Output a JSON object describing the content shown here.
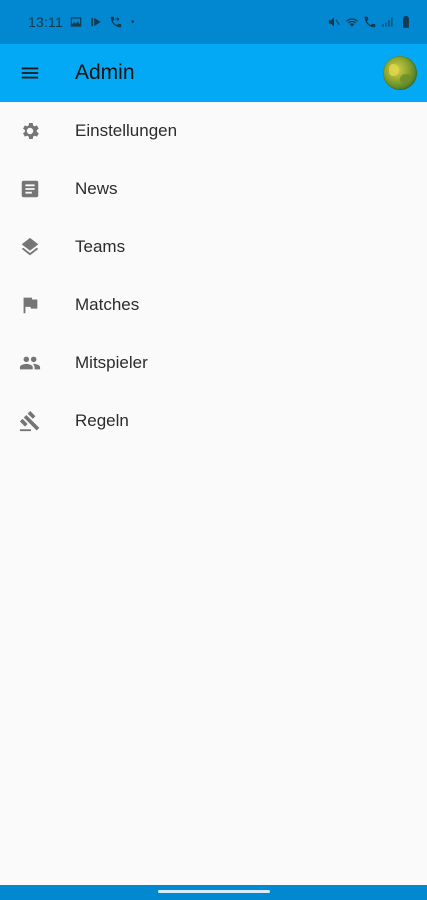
{
  "status_bar": {
    "time": "13:11",
    "left_icons": [
      "gallery-icon",
      "play-icon",
      "call-forward-icon"
    ],
    "dot": "•",
    "right_icons": [
      "mute-icon",
      "wifi-icon",
      "volte-icon",
      "signal-icon",
      "battery-icon"
    ]
  },
  "app_bar": {
    "title": "Admin",
    "menu_icon": "hamburger-menu-icon",
    "avatar": "user-avatar",
    "background": "#03a9f4"
  },
  "menu": {
    "items": [
      {
        "label": "Einstellungen",
        "icon": "gear-icon"
      },
      {
        "label": "News",
        "icon": "article-icon"
      },
      {
        "label": "Teams",
        "icon": "layers-icon"
      },
      {
        "label": "Matches",
        "icon": "flag-icon"
      },
      {
        "label": "Mitspieler",
        "icon": "people-icon"
      },
      {
        "label": "Regeln",
        "icon": "gavel-icon"
      }
    ]
  },
  "colors": {
    "status_bar": "#0288d1",
    "app_bar": "#03a9f4",
    "background": "#fafafa",
    "icon": "#757575",
    "text": "#2b2b2b"
  }
}
